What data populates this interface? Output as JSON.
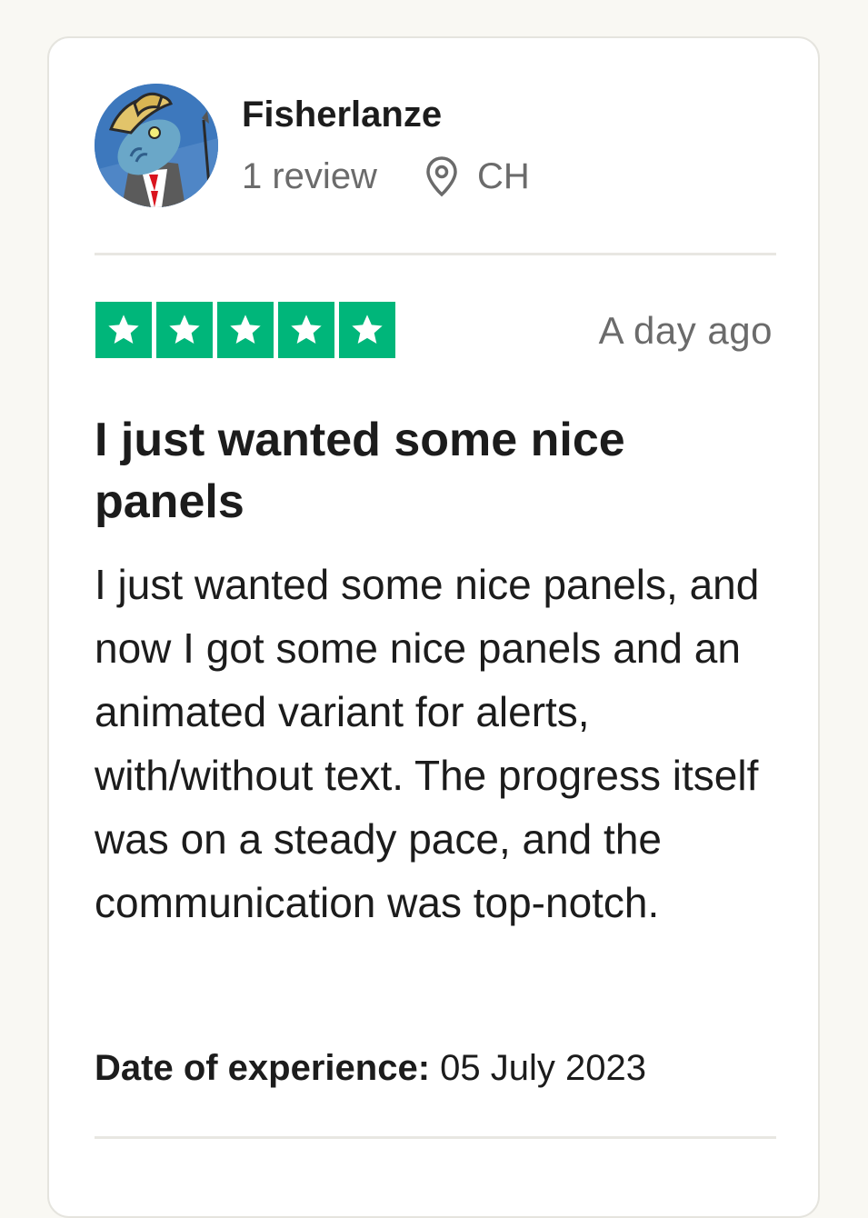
{
  "reviewer": {
    "name": "Fisherlanze",
    "review_count": "1 review",
    "country": "CH",
    "location_icon": "location-pin-icon",
    "avatar_icon": "fish-with-hat-avatar"
  },
  "review": {
    "rating": 5,
    "max_rating": 5,
    "star_color": "#00b67a",
    "posted": "A day ago",
    "title": "I just wanted some nice panels",
    "body": "I just wanted some nice panels, and now I got some nice panels and an animated variant for alerts, with/without text. The progress itself was on a steady pace, and the communication was top-notch.",
    "experience_label": "Date of experience:",
    "experience_date": "05 July 2023"
  }
}
